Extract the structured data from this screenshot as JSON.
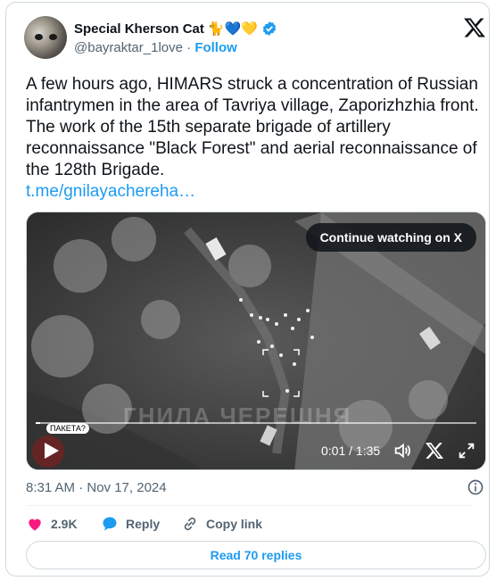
{
  "author": {
    "display_name": "Special Kherson Cat",
    "emoji": "🐈💙💛",
    "handle": "@bayraktar_1love",
    "separator": "·",
    "follow_label": "Follow"
  },
  "tweet": {
    "text": "A few hours ago, HIMARS struck a concentration of Russian infantrymen in the area of Tavriya village, Zaporizhzhia front. The work of the 15th separate brigade of artillery reconnaissance \"Black Forest\" and aerial reconnaissance of the 128th Brigade.",
    "link": "t.me/gnilayachereha…",
    "timestamp": "8:31 AM · Nov 17, 2024"
  },
  "video": {
    "continue_label": "Continue watching on X",
    "time": "0:01 / 1:35",
    "overlay_bubble": "ПАКЕТА?",
    "watermark": "ГНИЛА ЧЕРЕШНЯ",
    "progress": 0.01
  },
  "actions": {
    "likes": "2.9K",
    "reply_label": "Reply",
    "copy_link_label": "Copy link"
  },
  "read_replies_label": "Read 70 replies",
  "colors": {
    "accent": "#1d9bf0",
    "like": "#f91880",
    "verified": "#1d9bf0"
  },
  "icons": {
    "logo": "x-logo-icon",
    "verified": "verified-badge-icon",
    "play": "play-icon",
    "volume": "volume-icon",
    "fullscreen": "fullscreen-icon",
    "info": "info-icon",
    "like": "heart-icon",
    "reply": "reply-bubble-icon",
    "copy_link": "link-icon"
  }
}
